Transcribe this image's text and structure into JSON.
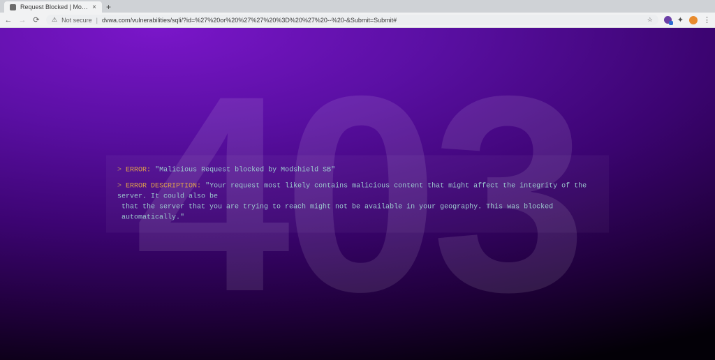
{
  "window": {
    "minimize": "—",
    "maximize": "▢",
    "close": "✕"
  },
  "browser": {
    "tab": {
      "title": "Request Blocked | Modsh",
      "close": "×"
    },
    "new_tab": "+",
    "nav": {
      "back": "←",
      "forward": "→",
      "reload": "⟳"
    },
    "omnibox": {
      "warn_icon": "⚠",
      "not_secure": "Not secure",
      "separator": "|",
      "url": "dvwa.com/vulnerabilities/sqli/?id=%27%20or%20%27%27%20%3D%20%27%20--%20-&Submit=Submit#",
      "star": "☆"
    },
    "menu": "⋮"
  },
  "page": {
    "code": "403",
    "error": {
      "chevron": ">",
      "label": "ERROR:",
      "text": "\"Malicious Request blocked by Modshield SB\""
    },
    "description": {
      "chevron": ">",
      "label": "ERROR DESCRIPTION:",
      "text_line1": "\"Your request most likely contains malicious content that might affect the integrity of the server. It could also be",
      "text_line2": "that the server that you are trying to reach might not be available in your geography. This was blocked automatically.\""
    }
  }
}
